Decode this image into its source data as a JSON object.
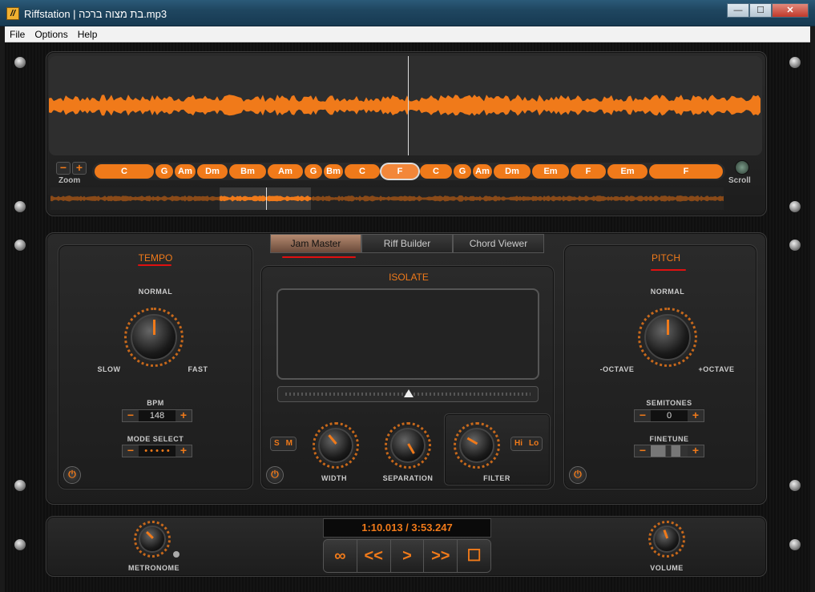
{
  "window": {
    "title": "Riffstation | בת מצוה ברכה.mp3",
    "app_icon": "//",
    "minimize": "—",
    "maximize": "☐",
    "close": "✕"
  },
  "menu": [
    "File",
    "Options",
    "Help"
  ],
  "waveform": {
    "zoom_label": "Zoom",
    "scroll_label": "Scroll",
    "zoom_out": "−",
    "zoom_in": "+",
    "chords": [
      "C",
      "G",
      "Am",
      "Dm",
      "Bm",
      "Am",
      "G",
      "Bm",
      "C",
      "F",
      "C",
      "G",
      "Am",
      "Dm",
      "Em",
      "F",
      "Em",
      "F"
    ],
    "selected_chord_index": 9
  },
  "tabs": [
    "Jam Master",
    "Riff Builder",
    "Chord Viewer"
  ],
  "active_tab": 0,
  "tempo": {
    "title": "TEMPO",
    "normal": "NORMAL",
    "slow": "SLOW",
    "fast": "FAST",
    "bpm_label": "BPM",
    "bpm_value": "148",
    "mode_label": "MODE SELECT",
    "mode_value": "• • • • •",
    "minus": "−",
    "plus": "+"
  },
  "isolate": {
    "title": "ISOLATE",
    "s": "S",
    "m": "M",
    "width": "WIDTH",
    "separation": "SEPARATION",
    "filter": "FILTER",
    "hi": "Hi",
    "lo": "Lo"
  },
  "pitch": {
    "title": "PITCH",
    "normal": "NORMAL",
    "minus_octave": "-OCTAVE",
    "plus_octave": "+OCTAVE",
    "semitones_label": "SEMITONES",
    "semitones_value": "0",
    "finetune_label": "FINETUNE",
    "minus": "−",
    "plus": "+"
  },
  "transport": {
    "time": "1:10.013 / 3:53.247",
    "loop": "∞",
    "rewind": "<<",
    "play": ">",
    "forward": ">>",
    "stop": "☐",
    "metronome": "METRONOME",
    "volume": "VOLUME"
  },
  "colors": {
    "accent": "#f07a1a",
    "title_bar": "#1f4660",
    "highlight_underline": "#e01010"
  }
}
